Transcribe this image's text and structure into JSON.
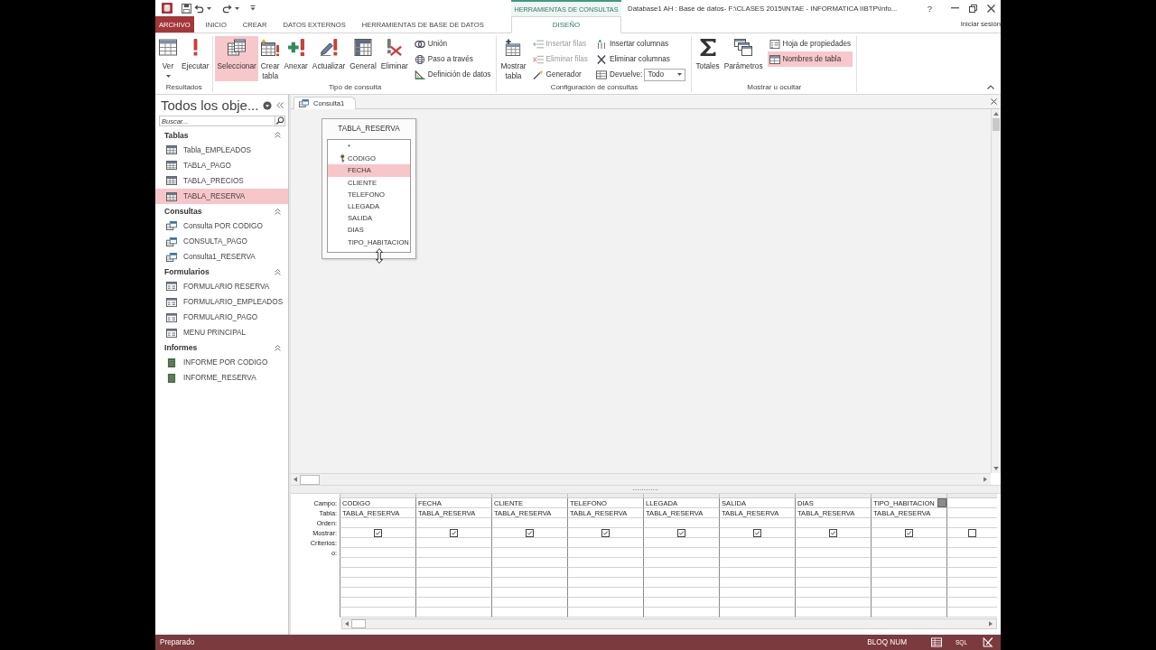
{
  "window": {
    "title": "Database1 AH : Base de datos- F:\\CLASES 2015\\INTAE - INFORMATICA IIBTP\\Info...",
    "help": "?",
    "sign_in": "Iniciar sesión"
  },
  "tabs": [
    {
      "label": "ARCHIVO",
      "kind": "file",
      "selected": false
    },
    {
      "label": "INICIO",
      "kind": "tab",
      "selected": false
    },
    {
      "label": "CREAR",
      "kind": "tab",
      "selected": false
    },
    {
      "label": "DATOS EXTERNOS",
      "kind": "tab",
      "selected": false
    },
    {
      "label": "HERRAMIENTAS DE BASE DE DATOS",
      "kind": "tab",
      "selected": false
    }
  ],
  "contextual_tabs": {
    "label": "HERRAMIENTAS DE CONSULTAS",
    "tabs": [
      {
        "label": "DISEÑO",
        "selected": true
      }
    ]
  },
  "ribbon": {
    "groups": [
      {
        "label": "Resultados",
        "items": [
          {
            "label": "Ver",
            "kind": "large",
            "dropdown": true,
            "selected": false
          },
          {
            "label": "Ejecutar",
            "kind": "large",
            "dropdown": false,
            "selected": false
          }
        ]
      },
      {
        "label": "Tipo de consulta",
        "items": [
          {
            "label": "Seleccionar",
            "kind": "large",
            "selected": true
          },
          {
            "label": "Crear tabla",
            "kind": "large",
            "selected": false
          },
          {
            "label": "Anexar",
            "kind": "large",
            "selected": false
          },
          {
            "label": "Actualizar",
            "kind": "large",
            "selected": false
          },
          {
            "label": "General",
            "kind": "large",
            "selected": false
          },
          {
            "label": "Eliminar",
            "kind": "large",
            "selected": false
          },
          {
            "label": "Unión",
            "kind": "small",
            "selected": false
          },
          {
            "label": "Paso a través",
            "kind": "small",
            "selected": false
          },
          {
            "label": "Definición de datos",
            "kind": "small",
            "selected": false
          }
        ]
      },
      {
        "label": "Configuración de consultas",
        "items": [
          {
            "label": "Mostrar tabla",
            "kind": "large",
            "disabled": false
          },
          {
            "label": "Insertar filas",
            "kind": "small",
            "disabled": true
          },
          {
            "label": "Eliminar filas",
            "kind": "small",
            "disabled": true
          },
          {
            "label": "Generador",
            "kind": "small",
            "disabled": false
          },
          {
            "label": "Insertar columnas",
            "kind": "small",
            "disabled": false
          },
          {
            "label": "Eliminar columnas",
            "kind": "small",
            "disabled": false
          },
          {
            "label": "Devuelve:",
            "kind": "combo",
            "value": "Todo",
            "disabled": false
          }
        ]
      },
      {
        "label": "Mostrar u ocultar",
        "items": [
          {
            "label": "Totales",
            "kind": "large",
            "selected": false
          },
          {
            "label": "Parámetros",
            "kind": "large",
            "selected": false
          },
          {
            "label": "Hoja de propiedades",
            "kind": "small",
            "selected": false
          },
          {
            "label": "Nombres de tabla",
            "kind": "small",
            "selected": true
          }
        ]
      }
    ]
  },
  "navigation_pane": {
    "title": "Todos los obje...",
    "search": {
      "placeholder": "Buscar..."
    },
    "groups": [
      {
        "label": "Tablas",
        "kind": "table",
        "expanded": true,
        "items": [
          {
            "label": "Tabla_EMPLEADOS",
            "selected": false
          },
          {
            "label": "TABLA_PAGO",
            "selected": false
          },
          {
            "label": "TABLA_PRECIOS",
            "selected": false
          },
          {
            "label": "TABLA_RESERVA",
            "selected": true
          }
        ]
      },
      {
        "label": "Consultas",
        "kind": "query",
        "expanded": true,
        "items": [
          {
            "label": "Consulta POR CODIGO",
            "selected": false
          },
          {
            "label": "CONSULTA_PAGO",
            "selected": false
          },
          {
            "label": "Consulta1_RESERVA",
            "selected": false
          }
        ]
      },
      {
        "label": "Formularios",
        "kind": "form",
        "expanded": true,
        "items": [
          {
            "label": "FORMULARIO RESERVA",
            "selected": false
          },
          {
            "label": "FORMULARIO_EMPLEADOS",
            "selected": false
          },
          {
            "label": "FORMULARIO_PAGO",
            "selected": false
          },
          {
            "label": "MENU PRINCIPAL",
            "selected": false
          }
        ]
      },
      {
        "label": "Informes",
        "kind": "report",
        "expanded": true,
        "items": [
          {
            "label": "INFORME POR CODIGO",
            "selected": false
          },
          {
            "label": "INFORME_RESERVA",
            "selected": false
          }
        ]
      }
    ]
  },
  "document": {
    "tabs": [
      {
        "label": "Consulta1",
        "selected": true
      }
    ],
    "table": {
      "title": "TABLA_RESERVA",
      "fields": [
        {
          "label": "*",
          "primary_key": false,
          "selected": false
        },
        {
          "label": "CODIGO",
          "primary_key": true,
          "selected": false
        },
        {
          "label": "FECHA",
          "primary_key": false,
          "selected": true
        },
        {
          "label": "CLIENTE",
          "primary_key": false,
          "selected": false
        },
        {
          "label": "TELEFONO",
          "primary_key": false,
          "selected": false
        },
        {
          "label": "LLEGADA",
          "primary_key": false,
          "selected": false
        },
        {
          "label": "SALIDA",
          "primary_key": false,
          "selected": false
        },
        {
          "label": "DIAS",
          "primary_key": false,
          "selected": false
        },
        {
          "label": "TIPO_HABITACION",
          "primary_key": false,
          "selected": false
        }
      ]
    },
    "grid": {
      "rows": [
        {
          "label": "Campo:",
          "kind": "field"
        },
        {
          "label": "Tabla:",
          "kind": "table"
        },
        {
          "label": "Orden:",
          "kind": "sort"
        },
        {
          "label": "Mostrar:",
          "kind": "show"
        },
        {
          "label": "Criterios:",
          "kind": "criteria"
        },
        {
          "label": "o:",
          "kind": "or"
        }
      ],
      "columns": [
        {
          "field": "CODIGO",
          "table": "TABLA_RESERVA",
          "show": true,
          "focused": false
        },
        {
          "field": "FECHA",
          "table": "TABLA_RESERVA",
          "show": true,
          "focused": false
        },
        {
          "field": "CLIENTE",
          "table": "TABLA_RESERVA",
          "show": true,
          "focused": false
        },
        {
          "field": "TELEFONO",
          "table": "TABLA_RESERVA",
          "show": true,
          "focused": false
        },
        {
          "field": "LLEGADA",
          "table": "TABLA_RESERVA",
          "show": true,
          "focused": false
        },
        {
          "field": "SALIDA",
          "table": "TABLA_RESERVA",
          "show": true,
          "focused": false
        },
        {
          "field": "DIAS",
          "table": "TABLA_RESERVA",
          "show": true,
          "focused": false
        },
        {
          "field": "TIPO_HABITACION",
          "table": "TABLA_RESERVA",
          "show": true,
          "focused": true
        },
        {
          "show": false,
          "focused": false
        }
      ]
    }
  },
  "status_bar": {
    "text": "Preparado",
    "indicator": "BLOQ NUM",
    "views": [
      {
        "kind": "datasheet"
      },
      {
        "kind": "sql",
        "label": "SQL"
      },
      {
        "kind": "design"
      }
    ]
  }
}
